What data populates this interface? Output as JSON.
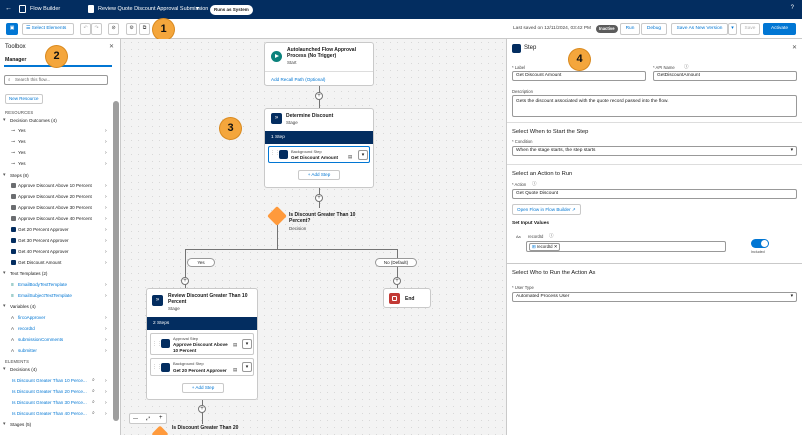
{
  "topbar": {
    "back": "←",
    "app_name": "Flow Builder",
    "flow_title": "Review Quote Discount Approval Submission - V1",
    "run_as": "Runs as System",
    "help": "?"
  },
  "toolbar": {
    "select_elements": "Select Elements",
    "last_saved": "Last saved on 12/11/2024, 03:42 PM",
    "status": "Inactive",
    "run": "Run",
    "debug": "Debug",
    "save_as_new_version": "Save As New Version",
    "save": "Save",
    "activate": "Activate"
  },
  "callouts": [
    "1",
    "2",
    "3",
    "4"
  ],
  "toolbox": {
    "title": "Toolbox",
    "tab": "Manager",
    "search_placeholder": "Search this flow...",
    "new_resource": "New Resource",
    "resources_header": "RESOURCES",
    "elements_header": "ELEMENTS",
    "groups": {
      "decision_outcomes": "Decision Outcomes (4)",
      "steps": "Steps (8)",
      "text_templates": "Text Templates (2)",
      "variables": "Variables (4)",
      "decisions": "Decisions (4)",
      "stages": "Stages (5)"
    },
    "decision_outcomes": [
      "Yes",
      "Yes",
      "Yes",
      "Yes"
    ],
    "steps": [
      "Approve Discount Above 10 Percent",
      "Approve Discount Above 20 Percent",
      "Approve Discount Above 30 Percent",
      "Approve Discount Above 40 Percent",
      "Get 20 Percent Approver",
      "Get 30 Percent Approver",
      "Get 40 Percent Approver",
      "Get Discount Amount"
    ],
    "text_templates": [
      "EmailBodyTextTemplate",
      "EmailSubjectTextTemplate"
    ],
    "variables": [
      "fircoApprover",
      "recordId",
      "submissionComments",
      "submitter"
    ],
    "decisions": [
      "Is Discount Greater Than 10 Perce...",
      "Is Discount Greater Than 20 Perce...",
      "Is Discount Greater Than 30 Perce...",
      "Is Discount Greater Than 40 Perce..."
    ],
    "colors": {
      "accent": "#0176d3",
      "step_icon": "#6b6d70",
      "step_blue": "#032d60",
      "template": "#0b827c"
    }
  },
  "canvas": {
    "start": {
      "title": "Autolaunched Flow Approval Process (No Trigger)",
      "subtitle": "Start",
      "recall": "Add Recall Path (Optional)"
    },
    "stage1": {
      "title": "Determine Discount",
      "subtitle": "Stage",
      "count": "1 Step",
      "step_type": "Background Step",
      "step_name": "Get Discount Amount",
      "add_step": "+ Add Step"
    },
    "decision": {
      "title": "Is Discount Greater Than 10 Percent?",
      "subtitle": "Decision",
      "yes": "Yes",
      "default": "No (Default)"
    },
    "stage2": {
      "title": "Review Discount Greater Than 10 Percent",
      "subtitle": "Stage",
      "count": "2 Steps",
      "step1_type": "Approval Step",
      "step1_name": "Approve Discount Above 10 Percent",
      "step2_type": "Background Step",
      "step2_name": "Get 20 Percent Approver",
      "add_step": "+ Add Step"
    },
    "end": {
      "title": "End"
    },
    "decision2": {
      "title": "Is Discount Greater Than 20"
    },
    "zoom": {
      "minus": "—",
      "fit": "⤢",
      "plus": "+"
    }
  },
  "panel": {
    "title": "Step",
    "label_lbl": "* Label",
    "label_val": "Get Discount Amount",
    "api_lbl": "* API Name",
    "api_val": "GetDiscountAmount",
    "desc_lbl": "Description",
    "desc_val": "Gets the discount associated with the quote record passed into the flow.",
    "when_header": "Select When to Start the Step",
    "cond_lbl": "* Condition",
    "cond_val": "When the stage starts, the step starts",
    "action_header": "Select an Action to Run",
    "action_lbl": "* Action",
    "action_val": "Get Quote Discount",
    "open_flow": "Open Flow in Flow Builder",
    "input_values": "Set Input Values",
    "record_lbl": "recordId",
    "record_token": "recordId",
    "included": "Included",
    "who_header": "Select Who to Run the Action As",
    "user_lbl": "* User Type",
    "user_val": "Automated Process User"
  }
}
